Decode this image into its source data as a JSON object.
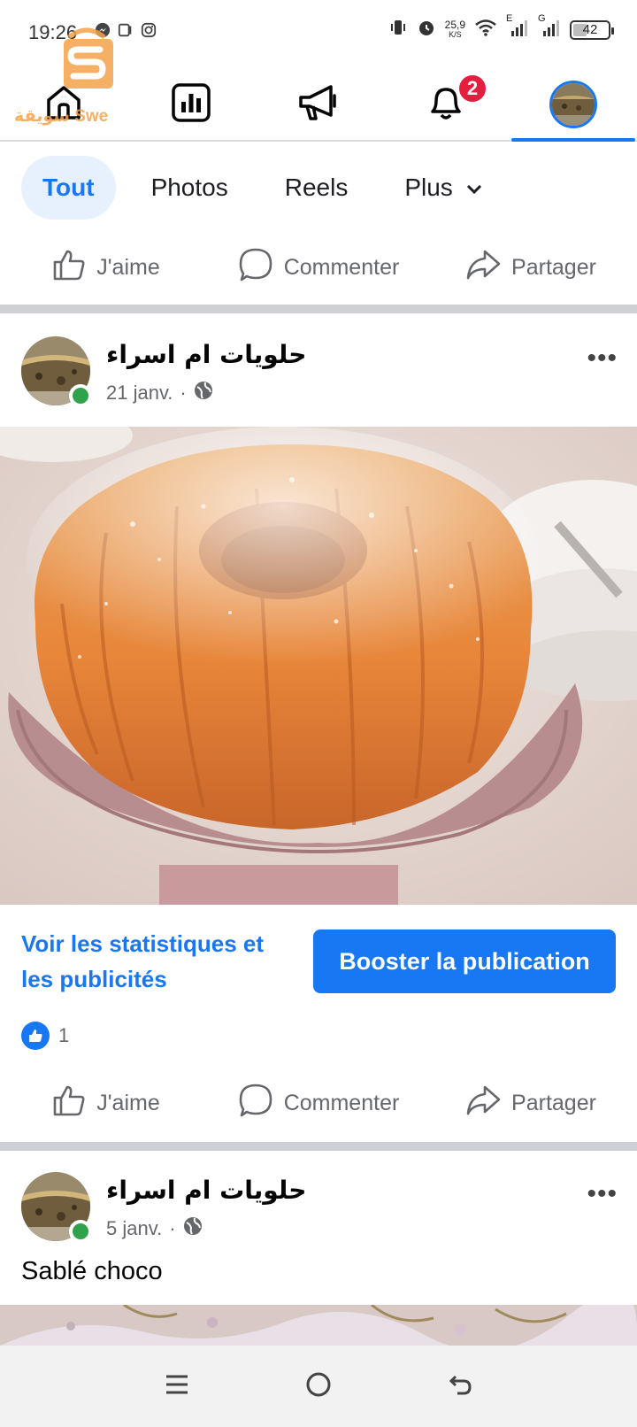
{
  "status_bar": {
    "time": "19:26",
    "net_speed_value": "25,9",
    "net_speed_unit": "K/S",
    "signal1_label": "E",
    "signal2_label": "G",
    "battery": "42"
  },
  "watermark": {
    "text": "سويقة Swe",
    "color": "#f5a24a"
  },
  "nav": {
    "items": [
      "home-icon",
      "insights-icon",
      "megaphone-icon",
      "bell-icon",
      "profile-avatar"
    ],
    "notifications_badge": "2",
    "active_index": 4
  },
  "filters": {
    "chips": [
      "Tout",
      "Photos",
      "Reels",
      "Plus"
    ],
    "active": "Tout"
  },
  "actions": {
    "like": "J'aime",
    "comment": "Commenter",
    "share": "Partager"
  },
  "posts": [
    {
      "author": "حلويات ام اسراء",
      "date": "21 janv.",
      "separator": "·",
      "image": "bundt cake dusted with powdered sugar on a pink cake stand",
      "stats_link": "Voir les statistiques et les publicités",
      "boost_button": "Booster la publication",
      "reaction_count": "1"
    },
    {
      "author": "حلويات ام اسراء",
      "date": "5 janv.",
      "separator": "·",
      "caption": "Sablé choco"
    }
  ],
  "colors": {
    "brand_blue": "#1877f2",
    "badge_red": "#e41e3f",
    "online_green": "#31a24c",
    "secondary_text": "#65676b"
  }
}
